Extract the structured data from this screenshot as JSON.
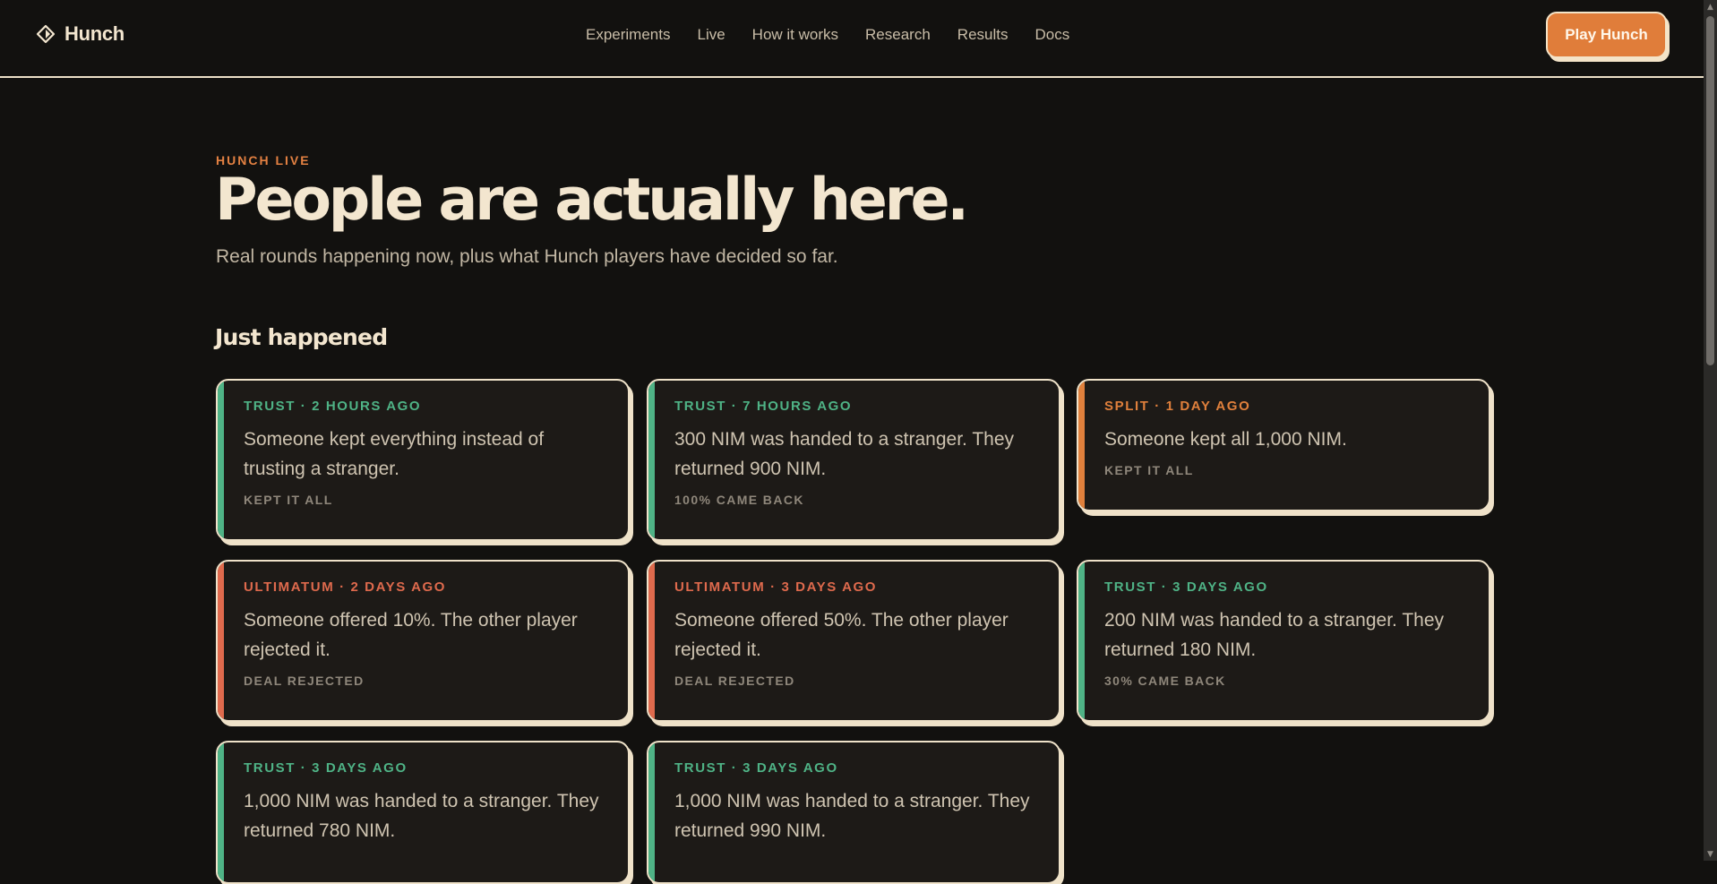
{
  "nav": {
    "brand": "Hunch",
    "links": [
      {
        "label": "Experiments"
      },
      {
        "label": "Live"
      },
      {
        "label": "How it works"
      },
      {
        "label": "Research"
      },
      {
        "label": "Results"
      },
      {
        "label": "Docs"
      }
    ],
    "cta_label": "Play Hunch"
  },
  "hero": {
    "eyebrow": "HUNCH LIVE",
    "title": "People are actually here.",
    "subtitle": "Real rounds happening now, plus what Hunch players have decided so far."
  },
  "section": {
    "heading": "Just happened"
  },
  "colors": {
    "background": "#12110f",
    "cream": "#f3e6cf",
    "accent_orange": "#e07d3a",
    "trust": "#4fb386",
    "split": "#e0803c",
    "ultimatum": "#df6a4d"
  },
  "cards": [
    {
      "type": "trust",
      "tag": "TRUST · 2 HOURS AGO",
      "text": "Someone kept everything instead of trusting a stranger.",
      "footer": "KEPT IT ALL"
    },
    {
      "type": "trust",
      "tag": "TRUST · 7 HOURS AGO",
      "text": "300 NIM was handed to a stranger. They returned 900 NIM.",
      "footer": "100% CAME BACK"
    },
    {
      "type": "split",
      "tag": "SPLIT · 1 DAY AGO",
      "text": "Someone kept all 1,000 NIM.",
      "footer": "KEPT IT ALL"
    },
    {
      "type": "ultimatum",
      "tag": "ULTIMATUM · 2 DAYS AGO",
      "text": "Someone offered 10%. The other player rejected it.",
      "footer": "DEAL REJECTED"
    },
    {
      "type": "ultimatum",
      "tag": "ULTIMATUM · 3 DAYS AGO",
      "text": "Someone offered 50%. The other player rejected it.",
      "footer": "DEAL REJECTED"
    },
    {
      "type": "trust",
      "tag": "TRUST · 3 DAYS AGO",
      "text": "200 NIM was handed to a stranger. They returned 180 NIM.",
      "footer": "30% CAME BACK"
    },
    {
      "type": "trust",
      "tag": "TRUST · 3 DAYS AGO",
      "text": "1,000 NIM was handed to a stranger. They returned 780 NIM."
    },
    {
      "type": "trust",
      "tag": "TRUST · 3 DAYS AGO",
      "text": "1,000 NIM was handed to a stranger. They returned 990 NIM."
    }
  ]
}
